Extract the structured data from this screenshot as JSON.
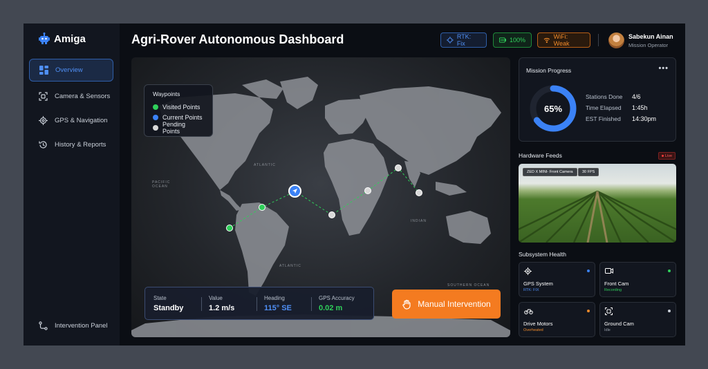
{
  "app": {
    "name": "Amiga"
  },
  "sidebar": {
    "items": [
      {
        "label": "Overview",
        "icon": "grid-icon"
      },
      {
        "label": "Camera & Sensors",
        "icon": "scan-icon"
      },
      {
        "label": "GPS & Navigation",
        "icon": "target-icon"
      },
      {
        "label": "History & Reports",
        "icon": "history-icon"
      }
    ],
    "footer_item": {
      "label": "Intervention Panel",
      "icon": "route-icon"
    }
  },
  "header": {
    "title": "Agri-Rover Autonomous Dashboard",
    "rtk": "RTK: Fix",
    "battery": "100%",
    "wifi": "WiFi: Weak",
    "user_name": "Sabekun Ainan",
    "user_role": "Mission Operator"
  },
  "map": {
    "legend": {
      "title": "Waypoints",
      "items": [
        {
          "label": "Visited Points",
          "color": "#2fcf5a"
        },
        {
          "label": "Current Points",
          "color": "#3b82f6"
        },
        {
          "label": "Pending Points",
          "color": "#d9d9d9"
        }
      ]
    },
    "stats": {
      "state_label": "State",
      "state_value": "Standby",
      "value_label": "Value",
      "value_value": "1.2 m/s",
      "heading_label": "Heading",
      "heading_value": "115° SE",
      "heading_color": "#4f8ff5",
      "gps_label": "GPS Accuracy",
      "gps_value": "0.02 m",
      "gps_color": "#2fcf5a"
    },
    "manual_button": "Manual Intervention"
  },
  "mission": {
    "title": "Mission Progress",
    "progress_label": "65%",
    "progress": 0.65,
    "rows": [
      {
        "label": "Stations Done",
        "value": "4/6"
      },
      {
        "label": "Time Elapsed",
        "value": "1:45h"
      },
      {
        "label": "EST Finished",
        "value": "14:30pm"
      }
    ]
  },
  "hardware": {
    "title": "Hardware Feeds",
    "live": "Live",
    "camera_name": "ZED X MINI- Front Camera",
    "fps": "30 FPS"
  },
  "subsystems": {
    "title": "Subsystem Health",
    "items": [
      {
        "name": "GPS System",
        "status": "RTK: FIX",
        "status_color": "#4f8ff5",
        "dot_color": "#3b82f6",
        "icon": "crosshair-icon"
      },
      {
        "name": "Front Cam",
        "status": "Recording",
        "status_color": "#2fcf5a",
        "dot_color": "#2fcf5a",
        "icon": "video-icon"
      },
      {
        "name": "Drive Motors",
        "status": "Overheated",
        "status_color": "#f08a2a",
        "dot_color": "#f08a2a",
        "icon": "bike-icon"
      },
      {
        "name": "Ground Cam",
        "status": "Idle",
        "status_color": "#9aa2ad",
        "dot_color": "#c9cfd8",
        "icon": "scan-icon"
      }
    ]
  }
}
